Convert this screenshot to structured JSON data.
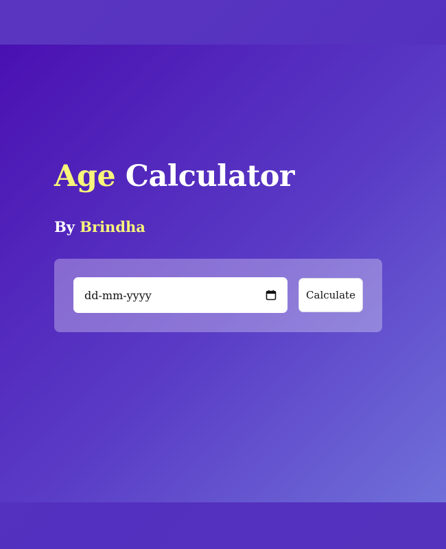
{
  "header": {
    "title_accent": "Age",
    "title_rest": "Calculator",
    "byline_prefix": "By",
    "byline_author": "Brindha"
  },
  "form": {
    "date_placeholder": "dd-mm-yyyy",
    "calculate_label": "Calculate"
  },
  "colors": {
    "accent": "#f8f57a",
    "text": "#ffffff",
    "gradient_start": "#4a10b2",
    "gradient_end": "#7070d9"
  },
  "icons": {
    "date_picker": "calendar-icon"
  }
}
